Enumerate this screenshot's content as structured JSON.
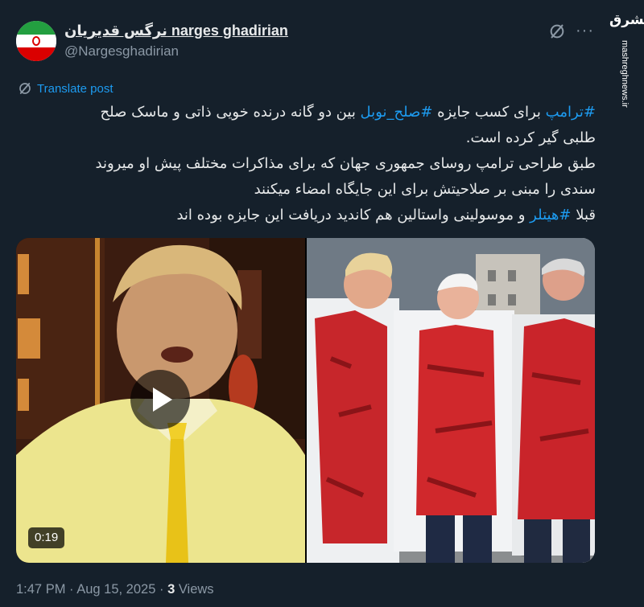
{
  "user": {
    "name": "نرگس قدیریان narges ghadirian",
    "handle": "@Nargesghadirian",
    "avatar_icon": "iran-flag-avatar"
  },
  "header": {
    "grok_icon": "grok-icon",
    "more_icon": "more-options-icon",
    "more_label": "···"
  },
  "watermark": {
    "logo": "مشرق",
    "url": "mashreghnews.ir"
  },
  "translate": {
    "label": "Translate post",
    "icon": "translate-icon"
  },
  "tweet": {
    "line1_hashtag": "#ترامپ",
    "line1_mid": " برای کسب جایزه ",
    "line1_hashtag2": "#صلح_نوبل",
    "line1_rest": " بین دو گانه درنده خویی ذاتی و ماسک صلح",
    "line2": "طلبی گیر کرده است.",
    "line3": "طبق طراحی ترامپ روسای جمهوری جهان که برای مذاکرات مختلف پیش او میروند",
    "line4": "سندی را مبنی بر صلاحیتش برای این جایگاه امضاء میکنند",
    "line5_start": "قبلا ",
    "line5_hashtag": "#هیتلر",
    "line5_rest": " و موسولینی واستالین هم کاندید دریافت این جایزه بوده اند"
  },
  "media": {
    "video_duration": "0:19",
    "play_icon": "play-icon"
  },
  "meta": {
    "time": "1:47 PM",
    "separator": " · ",
    "date": "Aug 15, 2025",
    "views_count": "3",
    "views_label": " Views"
  },
  "colors": {
    "background": "#15202b",
    "accent": "#1d9bf0",
    "text_primary": "#e7e9ea",
    "text_secondary": "#8b98a5"
  }
}
